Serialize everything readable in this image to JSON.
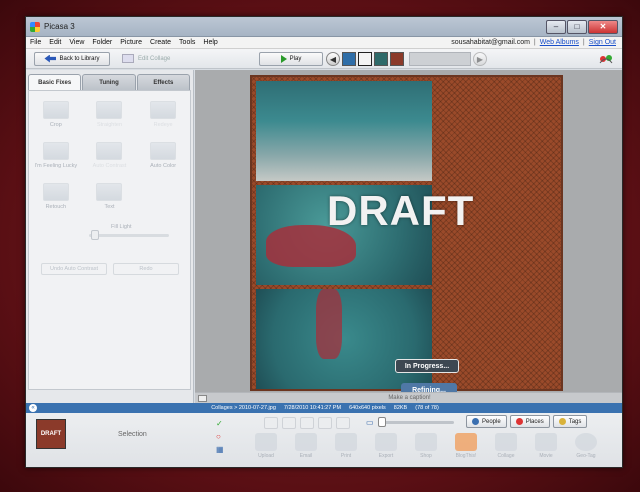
{
  "window": {
    "title": "Picasa 3",
    "controls": {
      "minimize": "–",
      "maximize": "□",
      "close": "✕"
    }
  },
  "menu": {
    "items": [
      "File",
      "Edit",
      "View",
      "Folder",
      "Picture",
      "Create",
      "Tools",
      "Help"
    ],
    "account": "sousahabitat@gmail.com",
    "separator": "|",
    "web_albums": "Web Albums",
    "sign_out": "Sign Out"
  },
  "toolbar": {
    "back_label": "Back to Library",
    "edit_collage_label": "Edit Collage",
    "play_label": "Play",
    "prev_icon": "◀",
    "next_icon": "▶"
  },
  "left_panel": {
    "tabs": [
      "Basic Fixes",
      "Tuning",
      "Effects"
    ],
    "tools": [
      "Crop",
      "Straighten",
      "Redeye",
      "I'm Feeling Lucky",
      "Auto Contrast",
      "Auto Color",
      "Retouch",
      "Text",
      ""
    ],
    "fill_light_label": "Fill Light",
    "undo_label": "Undo Auto Contrast",
    "redo_label": "Redo"
  },
  "canvas": {
    "watermark": "DRAFT",
    "in_progress_label": "In Progress...",
    "refining_label": "Refining..."
  },
  "caption_placeholder": "Make a caption!",
  "status": {
    "path": "Collages > 2010-07-27.jpg",
    "date": "7/28/2010 10:41:27 PM",
    "dimensions": "640x640 pixels",
    "size": "82KB",
    "position": "(78 of 78)"
  },
  "tray": {
    "thumb_label": "DRAFT",
    "selection_label": "Selection",
    "people_label": "People",
    "places_label": "Places",
    "tags_label": "Tags",
    "actions": [
      "Upload",
      "Email",
      "Print",
      "Export",
      "Shop",
      "BlogThis!",
      "Collage",
      "Movie",
      "Geo-Tag"
    ]
  },
  "colors": {
    "accent": "#3a72b0",
    "refining": "#4f78a6",
    "desktop": "#6b1418"
  }
}
